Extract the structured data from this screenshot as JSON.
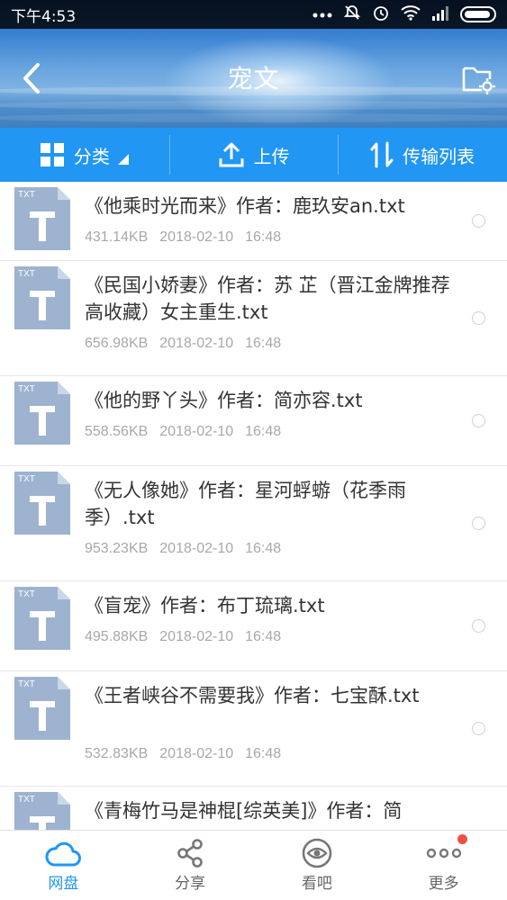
{
  "status_bar": {
    "time": "下午4:53"
  },
  "header": {
    "title": "宠文"
  },
  "toolbar": {
    "category_label": "分类",
    "upload_label": "上传",
    "transfer_label": "传输列表"
  },
  "files": [
    {
      "name": "《他乘时光而来》作者：鹿玖安an.txt",
      "size": "431.14KB",
      "date": "2018-02-10",
      "time": "16:48",
      "icon": "txt-file-icon"
    },
    {
      "name": "《民国小娇妻》作者：苏 芷（晋江金牌推荐 高收藏）女主重生.txt",
      "size": "656.98KB",
      "date": "2018-02-10",
      "time": "16:48",
      "icon": "txt-file-icon"
    },
    {
      "name": "《他的野丫头》作者：简亦容.txt",
      "size": "558.56KB",
      "date": "2018-02-10",
      "time": "16:48",
      "icon": "txt-file-icon"
    },
    {
      "name": "《无人像她》作者：星河蜉蝣（花季雨季）.txt",
      "size": "953.23KB",
      "date": "2018-02-10",
      "time": "16:48",
      "icon": "txt-file-icon"
    },
    {
      "name": "《盲宠》作者：布丁琉璃.txt",
      "size": "495.88KB",
      "date": "2018-02-10",
      "time": "16:48",
      "icon": "txt-file-icon"
    },
    {
      "name": "《王者峡谷不需要我》作者：七宝酥.txt",
      "size": "532.83KB",
      "date": "2018-02-10",
      "time": "16:48",
      "icon": "txt-file-icon"
    },
    {
      "name": "《青梅竹马是神棍[综英美]》作者：简",
      "size": "",
      "date": "",
      "time": "",
      "icon": "txt-file-icon"
    }
  ],
  "bottom_nav": [
    {
      "label": "网盘",
      "icon": "cloud-icon",
      "active": true
    },
    {
      "label": "分享",
      "icon": "share-icon",
      "active": false
    },
    {
      "label": "看吧",
      "icon": "eye-icon",
      "active": false
    },
    {
      "label": "更多",
      "icon": "more-dots-icon",
      "active": false
    }
  ],
  "colors": {
    "accent": "#2196f3",
    "badge": "#f04e45",
    "meta_text": "#a8a8a8"
  }
}
